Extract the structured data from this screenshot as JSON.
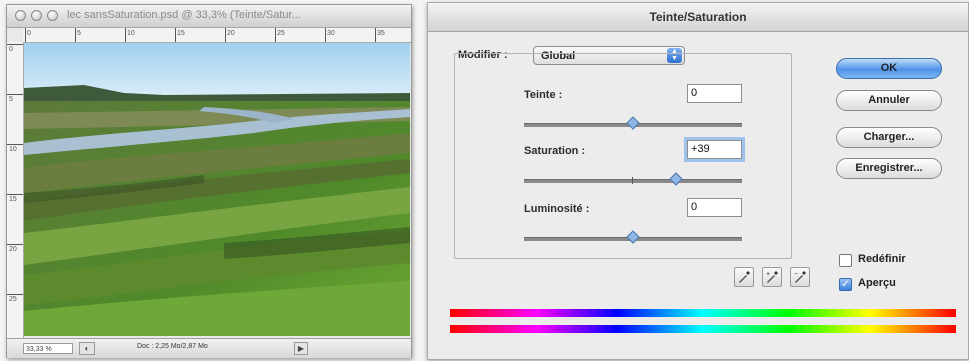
{
  "document": {
    "title": "lec sansSaturation.psd @ 33,3% (Teinte/Satur...",
    "ruler_top": [
      "0",
      "5",
      "10",
      "15",
      "20",
      "25",
      "30",
      "35"
    ],
    "ruler_left": [
      "0",
      "5",
      "10",
      "15",
      "20",
      "25"
    ],
    "zoom": "33,33 %",
    "doc_info": "Doc : 2,25 Mo/2,87 Mo"
  },
  "dialog": {
    "title": "Teinte/Saturation",
    "modifier_label": "Modifier :",
    "modifier_value": "Global",
    "hue": {
      "label": "Teinte :",
      "value": "0",
      "min": -180,
      "max": 180
    },
    "saturation": {
      "label": "Saturation :",
      "value": "+39",
      "min": -100,
      "max": 100
    },
    "lightness": {
      "label": "Luminosité :",
      "value": "0",
      "min": -100,
      "max": 100
    },
    "buttons": {
      "ok": "OK",
      "cancel": "Annuler",
      "load": "Charger...",
      "save": "Enregistrer..."
    },
    "colorize_label": "Redéfinir",
    "colorize_checked": false,
    "preview_label": "Aperçu",
    "preview_checked": true,
    "eyedroppers": [
      "eyedropper-icon",
      "eyedropper-plus-icon",
      "eyedropper-minus-icon"
    ]
  },
  "colors": {
    "ok_button": "#4f93e6",
    "dialog_bg": "#ececec",
    "focus_ring": "#9ec2ee"
  }
}
